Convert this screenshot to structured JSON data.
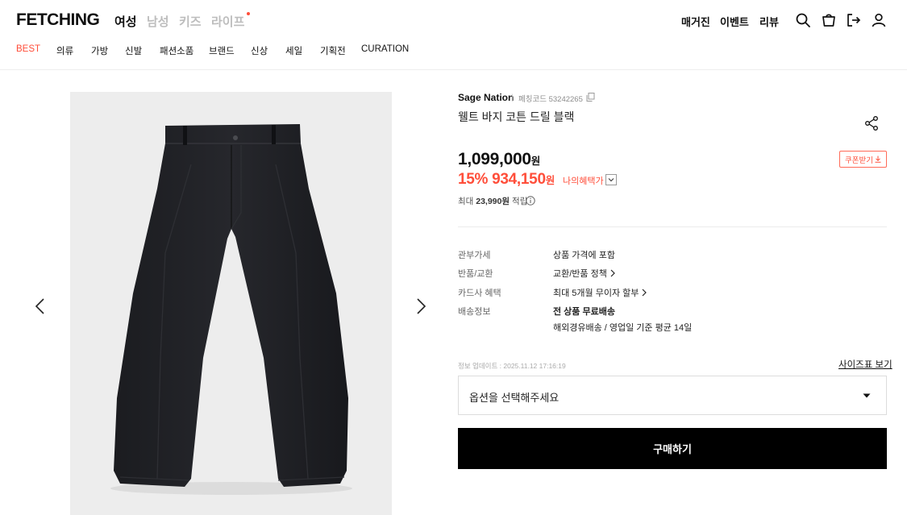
{
  "header": {
    "logo": "FETCHING",
    "gender_tabs": [
      {
        "label": "여성",
        "active": true
      },
      {
        "label": "남성",
        "active": false
      },
      {
        "label": "키즈",
        "active": false
      },
      {
        "label": "라이프",
        "active": false
      }
    ],
    "utility_links": [
      "매거진",
      "이벤트",
      "리뷰"
    ],
    "icons": [
      "search-icon",
      "shopping-bag-icon",
      "logout-icon",
      "user-icon"
    ],
    "accent_color": "#ff4e3a"
  },
  "categories": [
    "BEST",
    "의류",
    "가방",
    "신발",
    "패션소품",
    "브랜드",
    "신상",
    "세일",
    "기획전",
    "CURATION"
  ],
  "gallery": {
    "prev_icon": "chevron-left-icon",
    "next_icon": "chevron-right-icon"
  },
  "product": {
    "brand": "Sage Nation",
    "code_label": "페칭코드 53242265",
    "title": "웰트 바지 코튼 드릴 블랙",
    "original_price": "1,099,000",
    "currency": "원",
    "discount": "15%",
    "sale_price": "934,150",
    "benefit_label": "나의혜택가",
    "points_prefix": "최대",
    "points_amount": "23,990원",
    "points_suffix": "적립",
    "coupon_label": "쿠폰받기",
    "details": [
      {
        "label": "관부가세",
        "value": "상품 가격에 포함",
        "link": false
      },
      {
        "label": "반품/교환",
        "value": "교환/반품 정책",
        "link": true
      },
      {
        "label": "카드사 혜택",
        "value": "최대 5개월 무이자 할부",
        "link": true
      },
      {
        "label": "배송정보",
        "value": "전 상품 무료배송",
        "sub": "해외경유배송 / 영업일 기준 평균 14일"
      }
    ],
    "update_info": "정보 업데이트 : 2025.11.12 17:16:19",
    "size_chart": "사이즈표 보기",
    "option_placeholder": "옵션을 선택해주세요",
    "buy_button": "구매하기"
  }
}
